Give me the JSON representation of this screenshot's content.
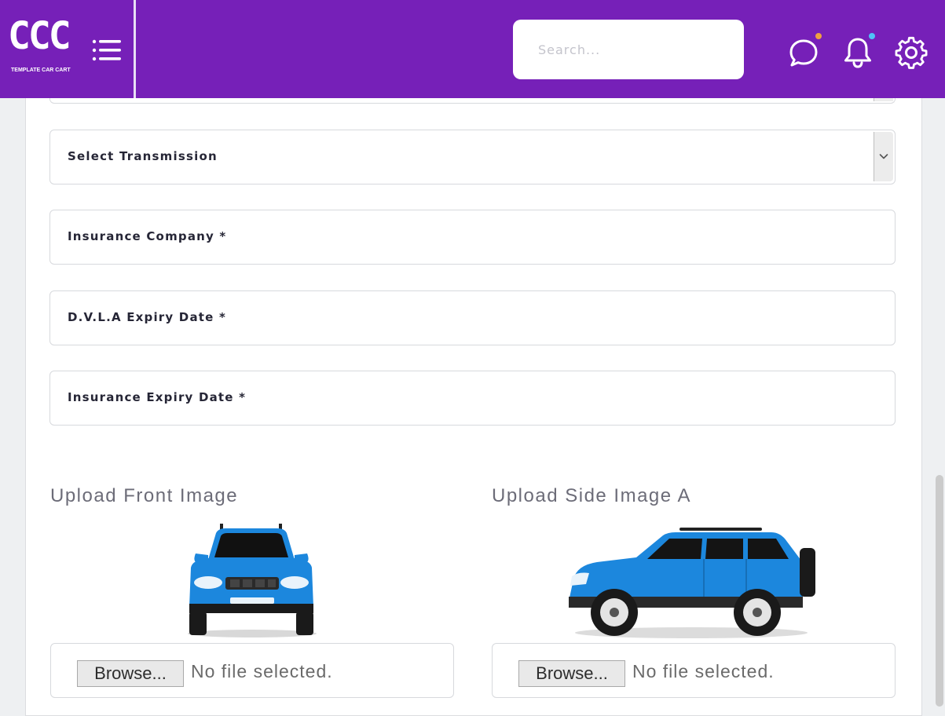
{
  "header": {
    "logo_text": "CCC",
    "logo_subtitle": "TEMPLATE CAR CART",
    "search_placeholder": "Search..."
  },
  "form": {
    "transmission_label": "Select Transmission",
    "insurance_company": "Insurance Company *",
    "dvla_expiry": "D.V.L.A Expiry Date *",
    "insurance_expiry": "Insurance Expiry Date *"
  },
  "uploads": [
    {
      "label": "Upload Front Image",
      "browse": "Browse...",
      "status": "No file selected."
    },
    {
      "label": "Upload Side Image A",
      "browse": "Browse...",
      "status": "No file selected."
    }
  ],
  "colors": {
    "header": "#7620b8",
    "car_body": "#1c87dd",
    "chat_dot": "#f0a040",
    "bell_dot": "#4fc3f7"
  },
  "icons": [
    "menu-icon",
    "chat-icon",
    "bell-icon",
    "gear-icon",
    "chevron-down-icon"
  ]
}
